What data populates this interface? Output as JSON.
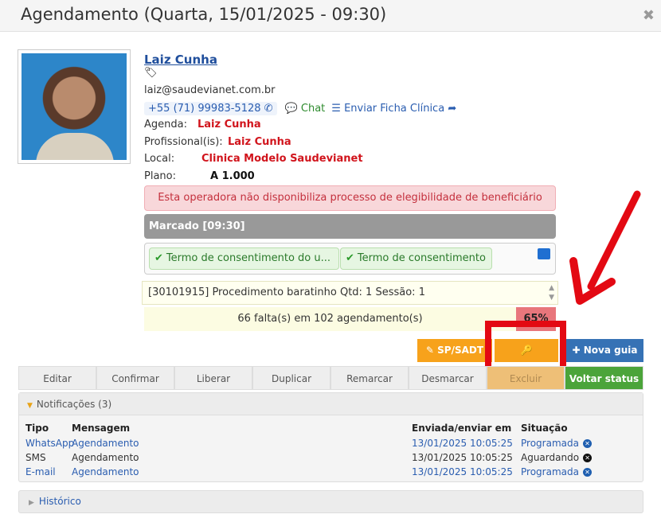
{
  "window": {
    "title": "Agendamento (Quarta, 15/01/2025 - 09:30)",
    "close_icon": "close-icon"
  },
  "patient": {
    "name": "Laiz Cunha",
    "tags_icon": "tags-icon",
    "email": "laiz@saudevianet.com.br",
    "phone": "+55 (71) 99983-5128",
    "chat_label": "Chat",
    "ficha_label": "Enviar Ficha Clínica"
  },
  "details": {
    "agenda_label": "Agenda:",
    "agenda_value": "Laiz Cunha",
    "prof_label": "Profissional(is):",
    "prof_value": "Laiz Cunha",
    "local_label": "Local:",
    "local_value": "Clinica Modelo Saudevianet",
    "plano_label": "Plano:",
    "plano_value": "A 1.000"
  },
  "alert": "Esta operadora não disponibiliza processo de elegibilidade de beneficiário",
  "status": "Marcado [09:30]",
  "consents": [
    "Termo de consentimento do u...",
    "Termo de consentimento"
  ],
  "procedure": "[30101915] Procedimento baratinho Qtd: 1 Sessão: 1",
  "faltas": {
    "text": "66 falta(s) em 102 agendamento(s)",
    "percent": "65%"
  },
  "buttons": {
    "sp_sadt": "SP/SADT",
    "nova_guia": "Nova guia"
  },
  "actions": [
    "Editar",
    "Confirmar",
    "Liberar",
    "Duplicar",
    "Remarcar",
    "Desmarcar",
    "Excluir",
    "Voltar status"
  ],
  "notifications": {
    "title": "Notificações (3)",
    "columns": [
      "Tipo",
      "Mensagem",
      "Enviada/enviar em",
      "Situação"
    ],
    "rows": [
      {
        "tipo": "WhatsApp",
        "mensagem": "Agendamento",
        "data": "13/01/2025 10:05:25",
        "situacao": "Programada"
      },
      {
        "tipo": "SMS",
        "mensagem": "Agendamento",
        "data": "13/01/2025 10:05:25",
        "situacao": "Aguardando"
      },
      {
        "tipo": "E-mail",
        "mensagem": "Agendamento",
        "data": "13/01/2025 10:05:25",
        "situacao": "Programada"
      }
    ]
  },
  "historico": "Histórico",
  "colors": {
    "accent_orange": "#f7a21b",
    "brand_blue": "#3672b5",
    "success_green": "#4ba43a",
    "alert_red": "#d1141c",
    "highlight_red": "#e30913"
  }
}
